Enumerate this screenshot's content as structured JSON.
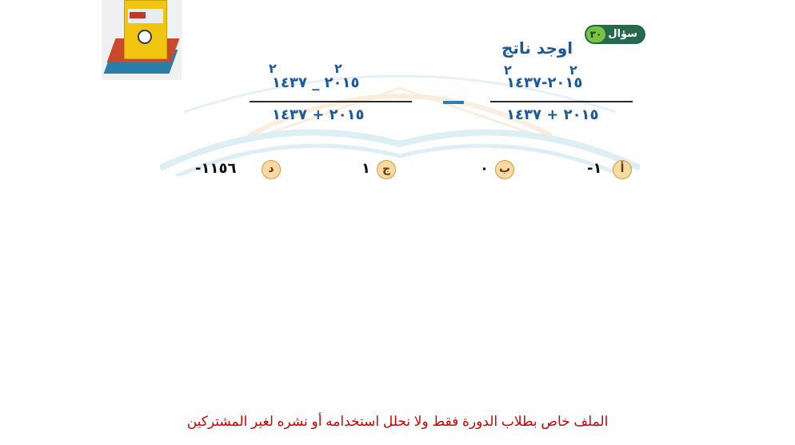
{
  "question": {
    "badge_label": "سؤال",
    "badge_number": "٣٠",
    "title": "اوجد ناتج"
  },
  "expression": {
    "right_fraction": {
      "numerator_exponents": [
        "٢",
        "٢"
      ],
      "numerator": "٢٠١٥-١٤٣٧",
      "denominator": "٢٠١٥ + ١٤٣٧"
    },
    "operator": "−",
    "left_fraction": {
      "numerator_exponents": [
        "٢",
        "٢"
      ],
      "numerator": "٢٠١٥ _ ١٤٣٧",
      "denominator": "٢٠١٥ + ١٤٣٧"
    }
  },
  "choices": [
    {
      "letter": "أ",
      "value": "-١"
    },
    {
      "letter": "ب",
      "value": "٠"
    },
    {
      "letter": "ج",
      "value": "١"
    },
    {
      "letter": "د",
      "value": "-١١٥٦"
    }
  ],
  "footer": "الملف خاص بطلاب الدورة فقط ولا نحلل استخدامه أو نشره لغير المشتركين",
  "colors": {
    "badge": "#23694c",
    "badge_number_bg": "#7cc242",
    "math_text": "#1a5a9a",
    "choice_circle": "#f6d9a3",
    "footer": "#d40000"
  }
}
